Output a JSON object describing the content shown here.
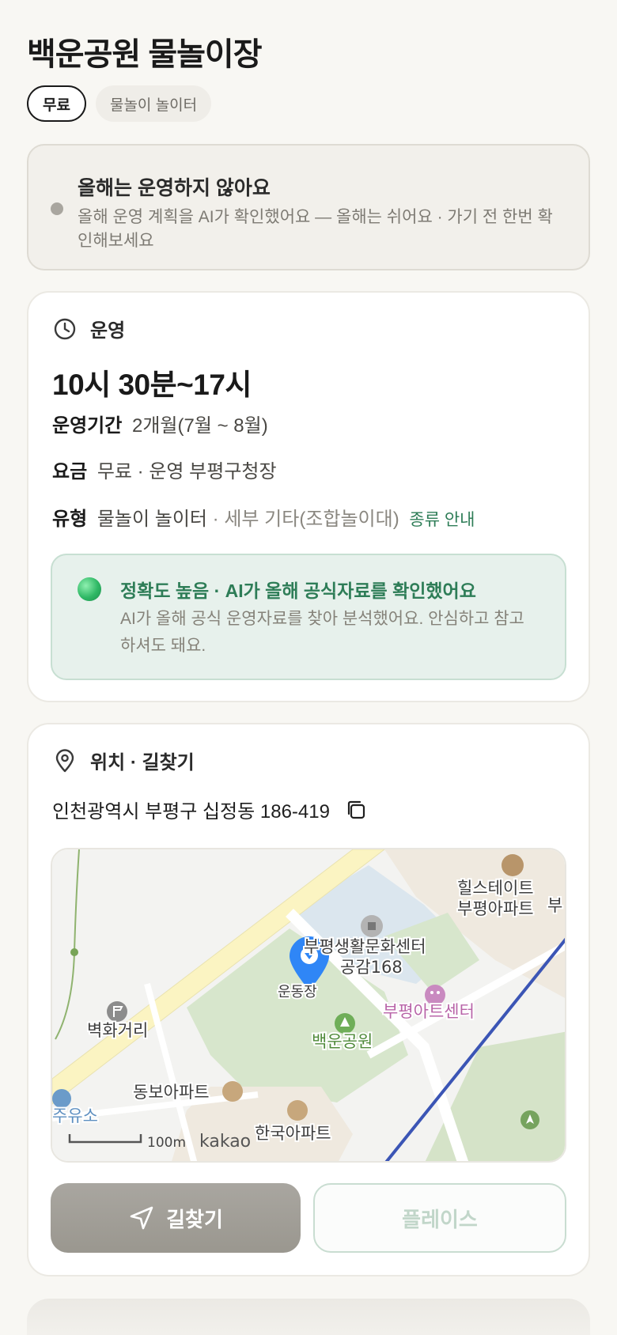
{
  "page": {
    "title": "백운공원 물놀이장"
  },
  "chips": [
    "무료",
    "물놀이 놀이터"
  ],
  "notice": {
    "title": "올해는 운영하지 않아요",
    "text": "올해 운영 계획을 AI가 확인했어요 — 올해는 쉬어요 · 가기 전 한번 확인해보세요"
  },
  "operation": {
    "header": "운영",
    "hours": "10시 30분~17시",
    "period_label": "운영기간",
    "period_value": "2개월(7월 ~ 8월)",
    "fee_label": "요금",
    "fee_value": "무료 · 운영 부평구청장",
    "type_label": "유형",
    "type_value": "물놀이 놀이터",
    "type_detail": " · 세부 기타(조합놀이대)",
    "type_link": "종류 안내",
    "accuracy": {
      "title": "정확도 높음 · AI가 올해 공식자료를 확인했어요",
      "text": "AI가 올해 공식 운영자료를 찾아 분석했어요. 안심하고 참고하셔도 돼요."
    }
  },
  "location": {
    "header": "위치 · 길찾기",
    "address": "인천광역시 부평구 십정동 186-419",
    "map": {
      "labels": {
        "culture_center_1": "부평생활문화센터",
        "culture_center_2": "공감168",
        "park_area": "운동장",
        "park_name": "백운공원",
        "art_center": "부평아트센터",
        "apt_hills_1": "힐스테이트",
        "apt_hills_2": "부평아파트",
        "apt_hills_cut": "부",
        "street": "벽화거리",
        "apt_dongbo": "동보아파트",
        "apt_hanguk": "한국아파트",
        "gas_station": "주유소",
        "scale": "100m",
        "logo": "kakao"
      }
    },
    "buttons": {
      "directions": "길찾기",
      "place": "플레이스"
    }
  },
  "colors": {
    "accent_green": "#2e7d57",
    "pin_blue": "#2f86f6",
    "primary_button": "#a3a09a"
  }
}
